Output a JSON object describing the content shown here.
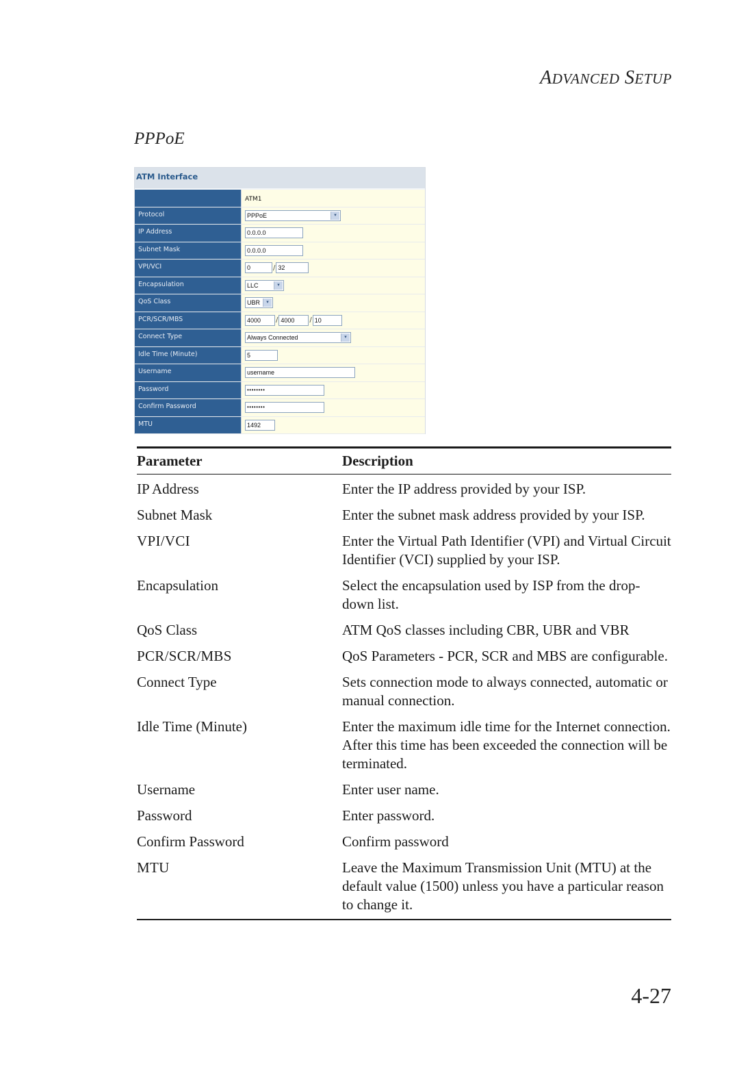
{
  "header": {
    "running_head_initial_1": "A",
    "running_head_rest_1": "DVANCED",
    "running_head_initial_2": "S",
    "running_head_rest_2": "ETUP"
  },
  "section_title": "PPPoE",
  "screenshot": {
    "panel_title": "ATM Interface",
    "interface_name": "ATM1",
    "fields": {
      "protocol": {
        "label": "Protocol",
        "value": "PPPoE"
      },
      "ip_address": {
        "label": "IP Address",
        "value": "0.0.0.0"
      },
      "subnet_mask": {
        "label": "Subnet Mask",
        "value": "0.0.0.0"
      },
      "vpi_vci": {
        "label": "VPI/VCI",
        "vpi": "0",
        "vci": "32",
        "separator": "/"
      },
      "encapsulation": {
        "label": "Encapsulation",
        "value": "LLC"
      },
      "qos_class": {
        "label": "QoS Class",
        "value": "UBR"
      },
      "pcr_scr_mbs": {
        "label": "PCR/SCR/MBS",
        "pcr": "4000",
        "scr": "4000",
        "mbs": "10",
        "separator": "/"
      },
      "connect_type": {
        "label": "Connect Type",
        "value": "Always Connected"
      },
      "idle_time": {
        "label": "Idle Time (Minute)",
        "value": "5"
      },
      "username": {
        "label": "Username",
        "value": "username"
      },
      "password": {
        "label": "Password",
        "value": "••••••••"
      },
      "confirm_password": {
        "label": "Confirm Password",
        "value": "••••••••"
      },
      "mtu": {
        "label": "MTU",
        "value": "1492"
      }
    },
    "dropdown_arrow": "▾"
  },
  "table": {
    "headers": {
      "parameter": "Parameter",
      "description": "Description"
    },
    "rows": [
      {
        "parameter": "IP Address",
        "description": "Enter the IP address provided by your ISP."
      },
      {
        "parameter": "Subnet Mask",
        "description": "Enter the subnet mask address provided by your ISP."
      },
      {
        "parameter": "VPI/VCI",
        "description": "Enter the Virtual Path Identifier (VPI) and Virtual Circuit Identifier (VCI) supplied by your ISP."
      },
      {
        "parameter": "Encapsulation",
        "description": "Select the encapsulation used by ISP from the drop-down list."
      },
      {
        "parameter": "QoS Class",
        "description": "ATM QoS classes including CBR, UBR and VBR"
      },
      {
        "parameter": "PCR/SCR/MBS",
        "description": "QoS Parameters - PCR, SCR and MBS are configurable."
      },
      {
        "parameter": "Connect Type",
        "description": "Sets connection mode to always connected, automatic or manual connection."
      },
      {
        "parameter": "Idle Time (Minute)",
        "description": "Enter the maximum idle time for the Internet connection. After this time has been exceeded the connection will be terminated."
      },
      {
        "parameter": "Username",
        "description": "Enter user name."
      },
      {
        "parameter": "Password",
        "description": "Enter password."
      },
      {
        "parameter": "Confirm Password",
        "description": "Confirm password"
      },
      {
        "parameter": "MTU",
        "description": "Leave the Maximum Transmission Unit (MTU) at the default value (1500) unless you have a particular reason to change it."
      }
    ]
  },
  "page_number": "4-27"
}
